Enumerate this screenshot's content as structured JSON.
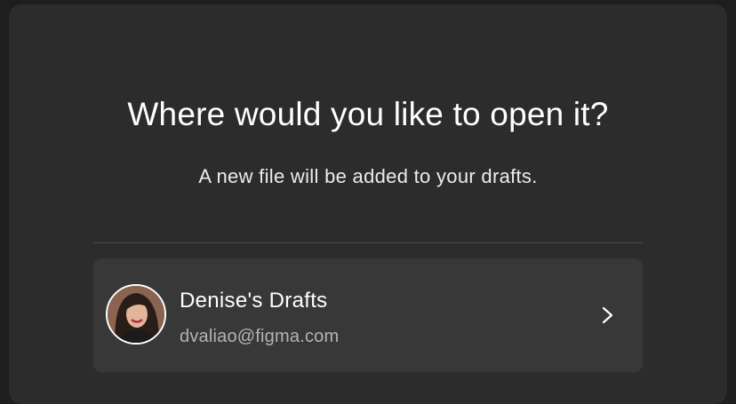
{
  "dialog": {
    "title": "Where would you like to open it?",
    "subtitle": "A new file will be added to your drafts."
  },
  "destination": {
    "name": "Denise's Drafts",
    "email": "dvaliao@figma.com",
    "avatar_icon": "user-avatar",
    "chevron_icon": "chevron-right-icon"
  },
  "colors": {
    "backdrop": "#1e1e1e",
    "modal_bg": "#2c2c2c",
    "card_bg": "#383838",
    "text_primary": "#ffffff",
    "text_secondary": "#b3b3b3"
  }
}
